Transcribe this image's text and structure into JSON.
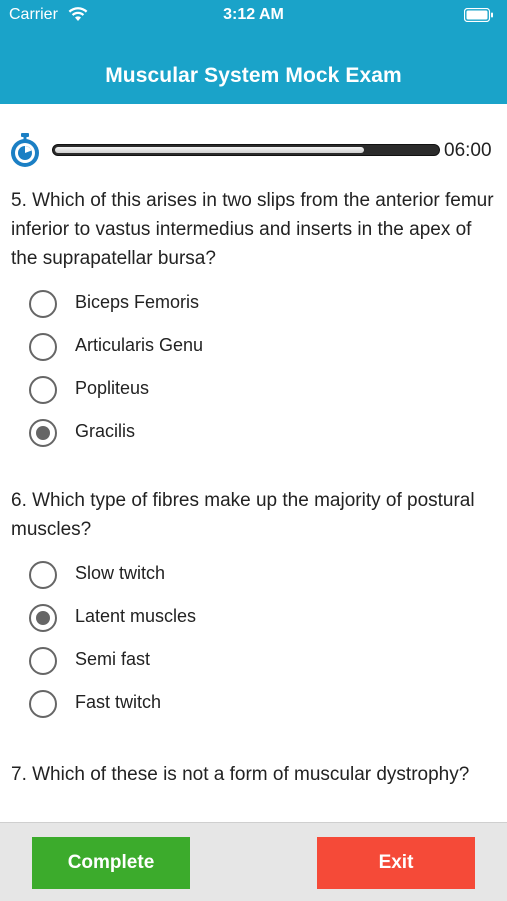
{
  "status_bar": {
    "carrier": "Carrier",
    "time": "3:12 AM"
  },
  "header": {
    "title": "Muscular System Mock Exam"
  },
  "timer": {
    "remaining": "06:00",
    "progress_fraction": 0.81
  },
  "questions": [
    {
      "text": "5. Which of this arises in two slips from the anterior femur inferior to vastus intermedius and inserts in the apex of the suprapatellar bursa?",
      "options": [
        "Biceps Femoris",
        "Articularis Genu",
        "Popliteus",
        "Gracilis"
      ],
      "selected_index": 3
    },
    {
      "text": "6. Which type of fibres make up the majority of postural muscles?",
      "options": [
        "Slow twitch",
        "Latent muscles",
        "Semi fast",
        "Fast twitch"
      ],
      "selected_index": 1
    },
    {
      "text": "7. Which of these is not a form of muscular dystrophy?",
      "options": [],
      "selected_index": null
    }
  ],
  "footer": {
    "complete_label": "Complete",
    "exit_label": "Exit"
  },
  "colors": {
    "header": "#1aa3c9",
    "complete": "#3cab2c",
    "exit": "#f54a38",
    "radio": "#666666"
  }
}
